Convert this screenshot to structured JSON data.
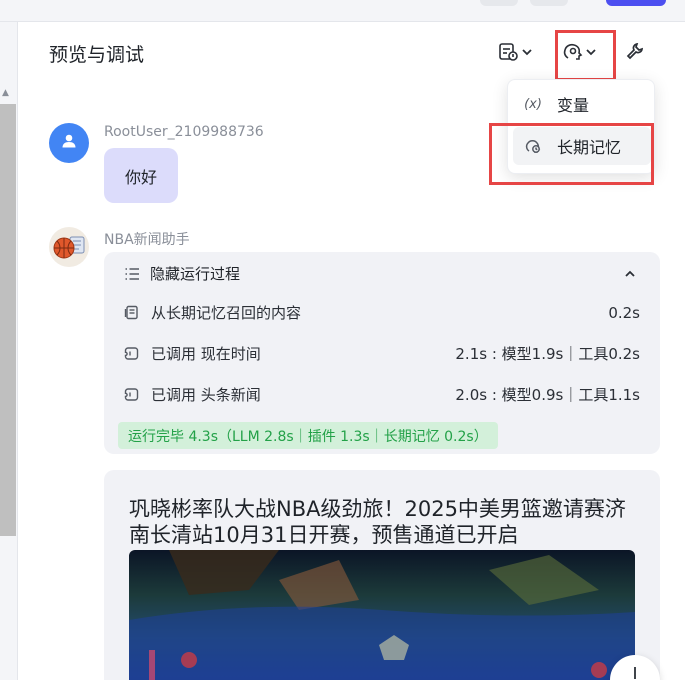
{
  "panel": {
    "title": "预览与调试"
  },
  "toolbar": {
    "debug_icon": "debug-list-icon",
    "memory_icon": "memory-brain-icon",
    "settings_icon": "wrench-icon"
  },
  "dropdown": {
    "items": [
      {
        "icon": "variable-icon",
        "icon_text": "(x)",
        "label": "变量"
      },
      {
        "icon": "long-term-memory-icon",
        "label": "长期记忆"
      }
    ]
  },
  "messages": {
    "user": {
      "name": "RootUser_2109988736",
      "text": "你好"
    },
    "bot": {
      "name": "NBA新闻助手"
    }
  },
  "process": {
    "header": "隐藏运行过程",
    "steps": [
      {
        "icon": "memory-recall-icon",
        "label": "从长期记忆召回的内容",
        "time": "0.2s"
      },
      {
        "icon": "plugin-icon",
        "label": "已调用 现在时间",
        "time": "2.1s : 模型1.9s｜工具0.2s"
      },
      {
        "icon": "plugin-icon",
        "label": "已调用 头条新闻",
        "time": "2.0s : 模型0.9s｜工具1.1s"
      }
    ],
    "summary": "运行完毕 4.3s（LLM 2.8s｜插件 1.3s｜长期记忆 0.2s）"
  },
  "news": {
    "title": "巩晓彬率队大战NBA级劲旅！2025中美男篮邀请赛济南长清站10月31日开赛，预售通道已开启"
  },
  "colors": {
    "accent": "#4c4ff0",
    "user_bubble": "#dcdcfb",
    "highlight": "#e64545",
    "success_bg": "#d3f0da",
    "success_text": "#23a148"
  }
}
